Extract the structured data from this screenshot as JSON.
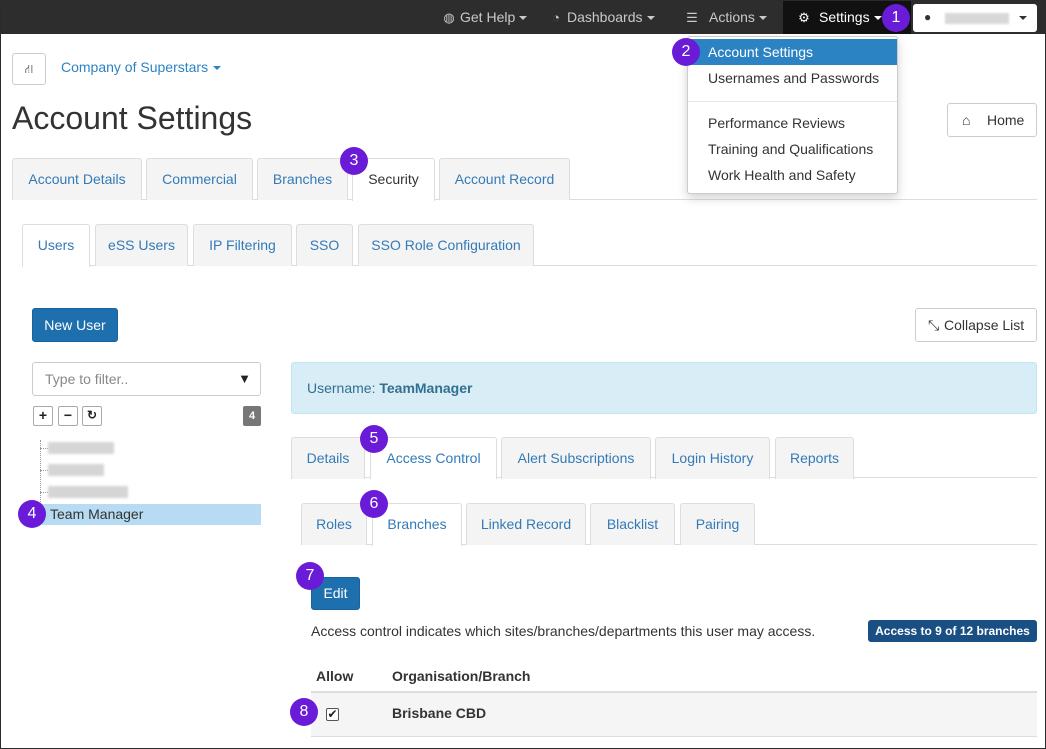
{
  "navbar": {
    "get_help": "Get Help",
    "dashboards": "Dashboards",
    "actions": "Actions",
    "settings": "Settings"
  },
  "settings_menu": {
    "items": [
      "Account Settings",
      "Usernames and Passwords",
      "Performance Reviews",
      "Training and Qualifications",
      "Work Health and Safety"
    ]
  },
  "header": {
    "company": "Company of Superstars",
    "title": "Account Settings",
    "home": "Home"
  },
  "main_tabs": [
    "Account Details",
    "Commercial",
    "Branches",
    "Security",
    "Account Record"
  ],
  "security_tabs": [
    "Users",
    "eSS Users",
    "IP Filtering",
    "SSO",
    "SSO Role Configuration"
  ],
  "users": {
    "new_user": "New User",
    "collapse_list": "Collapse List",
    "filter_placeholder": "Type to filter..",
    "count": "4",
    "selected": "Team Manager"
  },
  "detail": {
    "username_label": "Username:",
    "username": "TeamManager",
    "tabs": [
      "Details",
      "Access Control",
      "Alert Subscriptions",
      "Login History",
      "Reports"
    ],
    "subtabs": [
      "Roles",
      "Branches",
      "Linked Record",
      "Blacklist",
      "Pairing"
    ],
    "edit": "Edit",
    "description": "Access control indicates which sites/branches/departments this user may access.",
    "access_badge": "Access to 9 of 12 branches",
    "columns": [
      "Allow",
      "Organisation/Branch"
    ],
    "rows": [
      {
        "allow": "✔",
        "branch": "Brisbane CBD"
      }
    ]
  },
  "annotations": [
    "1",
    "2",
    "3",
    "4",
    "5",
    "6",
    "7",
    "8"
  ],
  "colors": {
    "navbar": "#2d2d2d",
    "accent": "#2c83c3",
    "badge": "#6a1bd8",
    "primary_button": "#1e6fae",
    "info_bg": "#d9edf7"
  }
}
